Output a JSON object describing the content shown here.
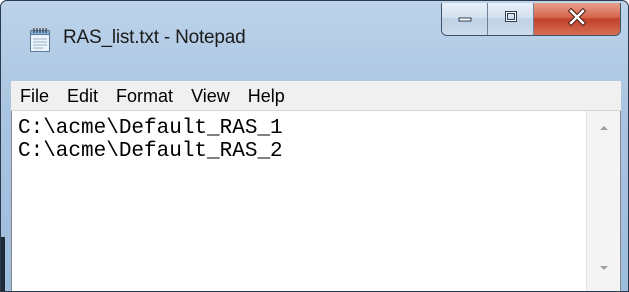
{
  "window": {
    "title": "RAS_list.txt - Notepad",
    "caption_buttons": [
      "minimize",
      "maximize",
      "close"
    ]
  },
  "menu": {
    "items": [
      "File",
      "Edit",
      "Format",
      "View",
      "Help"
    ]
  },
  "editor": {
    "lines": [
      "C:\\acme\\Default_RAS_1",
      "C:\\acme\\Default_RAS_2"
    ]
  },
  "icons": {
    "app": "notepad-icon",
    "minimize": "minimize-icon",
    "maximize": "maximize-icon",
    "close": "close-icon",
    "scroll_up": "scroll-up-arrow-icon",
    "scroll_down": "scroll-down-arrow-icon"
  },
  "colors": {
    "title_bar": "#a9c4e0",
    "close_button": "#c8452c",
    "menu_bar": "#f0f0f0",
    "editor_bg": "#ffffff"
  }
}
